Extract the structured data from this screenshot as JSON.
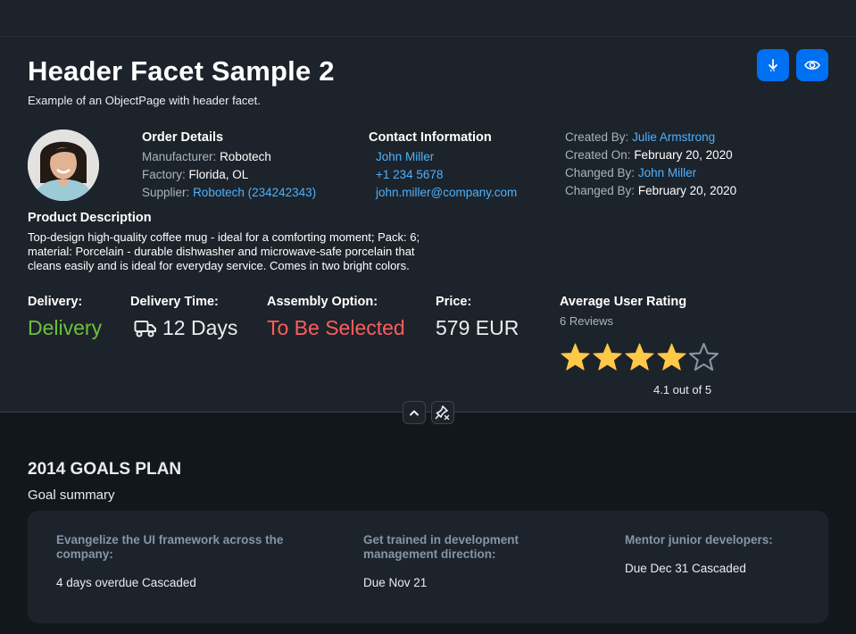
{
  "header": {
    "title": "Header Facet Sample 2",
    "subtitle": "Example of an ObjectPage with header facet."
  },
  "actions": {
    "download_icon": "download-icon",
    "view_icon": "eye-icon"
  },
  "order_details": {
    "title": "Order Details",
    "manufacturer_label": "Manufacturer:",
    "manufacturer_value": "Robotech",
    "factory_label": "Factory:",
    "factory_value": "Florida, OL",
    "supplier_label": "Supplier:",
    "supplier_value": "Robotech (234242343)"
  },
  "contact": {
    "title": "Contact Information",
    "name": "John Miller",
    "phone": "+1 234 5678",
    "email": "john.miller@company.com"
  },
  "admin": {
    "created_by_label": "Created By:",
    "created_by_value": "Julie Armstrong",
    "created_on_label": "Created On:",
    "created_on_value": "February 20, 2020",
    "changed_by_label": "Changed By:",
    "changed_by_value": "John Miller",
    "changed_on_label": "Changed By:",
    "changed_on_value": "February 20, 2020"
  },
  "product": {
    "title": "Product Description",
    "text": "Top-design high-quality coffee mug - ideal for a comforting moment; Pack: 6; material: Porcelain - durable dishwasher and microwave-safe porcelain that cleans easily and is ideal for everyday service. Comes in two bright colors."
  },
  "kpis": {
    "delivery_label": "Delivery:",
    "delivery_value": "Delivery",
    "delivery_time_label": "Delivery Time:",
    "delivery_time_value": "12 Days",
    "assembly_label": "Assembly Option:",
    "assembly_value": "To Be Selected",
    "price_label": "Price:",
    "price_value": "579 EUR"
  },
  "rating": {
    "title": "Average User Rating",
    "reviews": "6 Reviews",
    "value": 4.1,
    "max": 5,
    "text": "4.1 out of 5"
  },
  "section": {
    "title": "2014 GOALS PLAN",
    "subtitle": "Goal summary"
  },
  "goals": [
    {
      "title": "Evangelize the UI framework across the company:",
      "status": "4 days overdue Cascaded"
    },
    {
      "title": "Get trained in development management direction:",
      "status": "Due Nov 21"
    },
    {
      "title": "Mentor junior developers:",
      "status": "Due Dec 31 Cascaded"
    }
  ],
  "colors": {
    "accent": "#0070f2",
    "link": "#4db1ff",
    "positive": "#6fbf3e",
    "negative": "#ff5c5c",
    "star": "#ffc847"
  }
}
